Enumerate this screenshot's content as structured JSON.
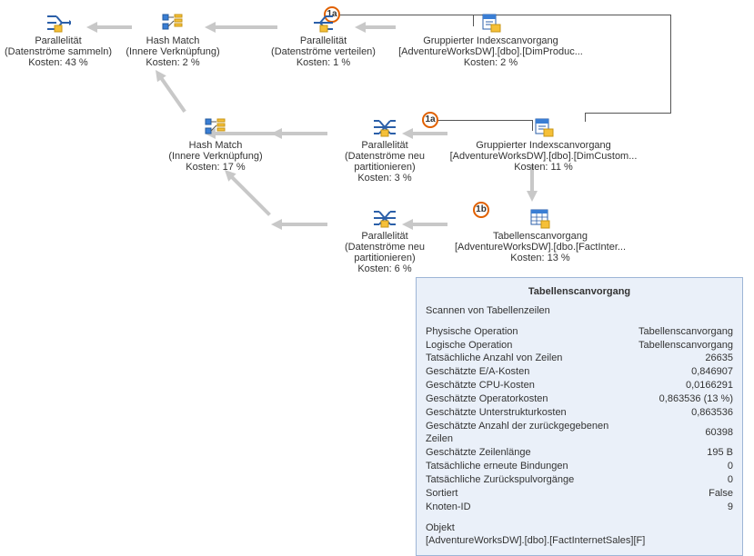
{
  "badges": {
    "b1a_top": "1a",
    "b1a_mid": "1a",
    "b1b": "1b"
  },
  "nodes": {
    "n1": {
      "title": "Parallelität",
      "sub": "(Datenströme sammeln)",
      "cost": "Kosten: 43 %"
    },
    "n2": {
      "title": "Hash Match",
      "sub": "(Innere Verknüpfung)",
      "cost": "Kosten: 2 %"
    },
    "n3": {
      "title": "Parallelität",
      "sub": "(Datenströme verteilen)",
      "cost": "Kosten: 1 %"
    },
    "n4": {
      "title": "Gruppierter Indexscanvorgang",
      "sub": "[AdventureWorksDW].[dbo].[DimProduc...",
      "cost": "Kosten: 2 %"
    },
    "n5": {
      "title": "Hash Match",
      "sub": "(Innere Verknüpfung)",
      "cost": "Kosten: 17 %"
    },
    "n6": {
      "title": "Parallelität",
      "sub": "(Datenströme neu partitionieren)",
      "cost": "Kosten: 3 %"
    },
    "n7": {
      "title": "Gruppierter Indexscanvorgang",
      "sub": "[AdventureWorksDW].[dbo].[DimCustom...",
      "cost": "Kosten: 11 %"
    },
    "n8": {
      "title": "Parallelität",
      "sub": "(Datenströme neu partitionieren)",
      "cost": "Kosten: 6 %"
    },
    "n9": {
      "title": "Tabellenscanvorgang",
      "sub": "[AdventureWorksDW].[dbo.[FactInter...",
      "cost": "Kosten: 13 %"
    }
  },
  "tooltip": {
    "title": "Tabellenscanvorgang",
    "desc": "Scannen von Tabellenzeilen",
    "rows": [
      {
        "k": "Physische Operation",
        "v": "Tabellenscanvorgang"
      },
      {
        "k": "Logische Operation",
        "v": "Tabellenscanvorgang"
      },
      {
        "k": "Tatsächliche Anzahl von Zeilen",
        "v": "26635"
      },
      {
        "k": "Geschätzte E/A-Kosten",
        "v": "0,846907"
      },
      {
        "k": "Geschätzte CPU-Kosten",
        "v": "0,0166291"
      },
      {
        "k": "Geschätzte Operatorkosten",
        "v": "0,863536 (13 %)"
      },
      {
        "k": "Geschätzte Unterstrukturkosten",
        "v": "0,863536"
      },
      {
        "k": "Geschätzte Anzahl der zurückgegebenen Zeilen",
        "v": "60398"
      },
      {
        "k": "Geschätzte Zeilenlänge",
        "v": "195 B"
      },
      {
        "k": "Tatsächliche erneute Bindungen",
        "v": "0"
      },
      {
        "k": "Tatsächliche Zurückspulvorgänge",
        "v": "0"
      },
      {
        "k": "Sortiert",
        "v": "False"
      },
      {
        "k": "Knoten-ID",
        "v": "9"
      }
    ],
    "objLabel": "Objekt",
    "objValue": "[AdventureWorksDW].[dbo].[FactInternetSales][F]"
  }
}
